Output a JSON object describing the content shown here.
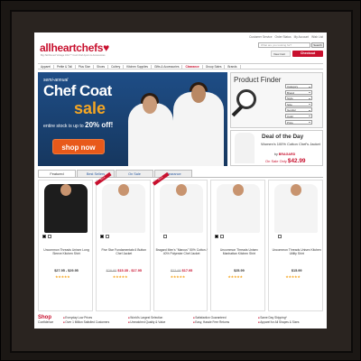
{
  "header": {
    "top_links": [
      "Customer Service",
      "Order Status",
      "My Account",
      "Wish List"
    ],
    "logo_text": "allheartchefs",
    "tagline": "Big-Tall Dexed Vintage Chic™ Cool Chef Apron & Accessories",
    "search_placeholder": "What are you looking for?",
    "search_button": "Search",
    "view_cart": "View Cart",
    "checkout": "Checkout"
  },
  "nav": {
    "items": [
      "Apparel",
      "Petite & Tall",
      "Plus Size",
      "Shoes",
      "Cutlery",
      "Kitchen Supplies",
      "Gifts & Accessories",
      "Clearance",
      "Group Sales",
      "Brands"
    ]
  },
  "hero": {
    "semi": "semi-annual",
    "title": "Chef Coat",
    "sale": "sale",
    "desc_prefix": "entire stock is up to",
    "desc_value": "20% off!",
    "button": "shop now"
  },
  "finder": {
    "title": "Product Finder",
    "selects": [
      "Category",
      "Brand",
      "Style",
      "Size",
      "Gender",
      "Color",
      "Price"
    ]
  },
  "deal": {
    "title": "Deal of the Day",
    "product": "Women's 100% Cotton Chef's Jacket",
    "by_label": "by",
    "brand": "BRAGARD",
    "price_label": "On Sale Only",
    "price": "$42.99"
  },
  "tabs": [
    "Featured",
    "Best Sellers",
    "On Sale",
    "Clearance"
  ],
  "products": [
    {
      "name": "Uncommon Threads Unisex Long Sleeve Kitchen Shirt",
      "old": "",
      "new": "",
      "price": "$27.95 - $29.95",
      "stars": "★★★★★",
      "dark": true,
      "banner": ""
    },
    {
      "name": "Five Star Fundamentals 6 Button Chef Jacket",
      "old": "$29.95",
      "new": "$15.35 - $17.95",
      "price": "",
      "stars": "★★★★★",
      "dark": false,
      "banner": "SALE"
    },
    {
      "name": "Bragard Men's \"Marcus\" 50% Cotton / 40% Polyester Chef Jacket",
      "old": "$22.95",
      "new": "$17.95",
      "price": "",
      "stars": "★★★★★",
      "dark": false,
      "banner": "SALE"
    },
    {
      "name": "Uncommon Threads Unisex Manhattan Kitchen Shirt",
      "old": "",
      "new": "",
      "price": "$25.99",
      "stars": "★★★★★",
      "dark": false,
      "banner": ""
    },
    {
      "name": "Uncommon Threads Unisex Kitchen Utility Shirt",
      "old": "",
      "new": "",
      "price": "$15.99",
      "stars": "★★★★★",
      "dark": false,
      "banner": ""
    }
  ],
  "benefits": {
    "title": "Shop",
    "subtitle": "Confidence",
    "col1": [
      "Everyday Low Prices",
      "Over 1 Million Satisfied Customers"
    ],
    "col2": [
      "World's Largest Selection",
      "Unmatched Quality & Value"
    ],
    "col3": [
      "Satisfaction Guaranteed",
      "Easy, Hassle Free Returns"
    ],
    "col4": [
      "Same Day Shipping*",
      "Apparel for All Shapes & Sizes"
    ]
  },
  "colors": {
    "brand": "#c8102e",
    "hero_bg": "#1e4d86",
    "accent": "#e8591a",
    "gold": "#f5a623"
  }
}
